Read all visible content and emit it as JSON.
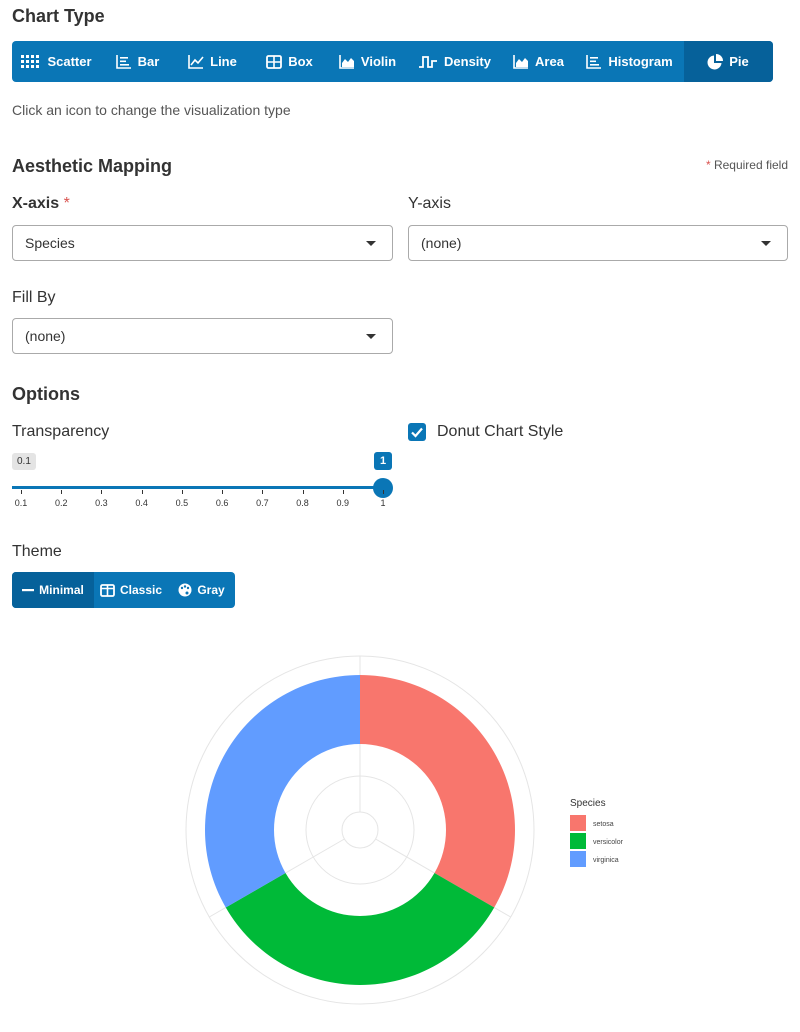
{
  "chart_type_section": {
    "title": "Chart Type",
    "buttons": [
      {
        "label": "Scatter",
        "icon": "scatter-icon"
      },
      {
        "label": "Bar",
        "icon": "bar-chart-icon"
      },
      {
        "label": "Line",
        "icon": "line-chart-icon"
      },
      {
        "label": "Box",
        "icon": "box-plot-icon"
      },
      {
        "label": "Violin",
        "icon": "violin-icon"
      },
      {
        "label": "Density",
        "icon": "density-icon"
      },
      {
        "label": "Area",
        "icon": "area-chart-icon"
      },
      {
        "label": "Histogram",
        "icon": "histogram-icon"
      },
      {
        "label": "Pie",
        "icon": "pie-chart-icon",
        "active": true
      }
    ],
    "helper": "Click an icon to change the visualization type"
  },
  "aesthetic": {
    "title": "Aesthetic Mapping",
    "required_note": "Required field",
    "x_axis": {
      "label": "X-axis",
      "value": "Species"
    },
    "y_axis": {
      "label": "Y-axis",
      "value": "(none)"
    },
    "fill_by": {
      "label": "Fill By",
      "value": "(none)"
    }
  },
  "options": {
    "title": "Options",
    "transparency": {
      "label": "Transparency",
      "min_label": "0.1",
      "value_label": "1",
      "value": 1,
      "min": 0.1,
      "max": 1,
      "ticks": [
        "0.1",
        "0.2",
        "0.3",
        "0.4",
        "0.5",
        "0.6",
        "0.7",
        "0.8",
        "0.9",
        "1"
      ]
    },
    "donut": {
      "label": "Donut Chart Style",
      "checked": true
    }
  },
  "theme": {
    "title": "Theme",
    "buttons": [
      {
        "label": "Minimal",
        "icon": "minus-icon",
        "active": true
      },
      {
        "label": "Classic",
        "icon": "columns-icon"
      },
      {
        "label": "Gray",
        "icon": "palette-icon"
      }
    ]
  },
  "colors": {
    "accent": "#0a76b6",
    "accent_active": "#06619a",
    "required": "#d9534f"
  },
  "chart_data": {
    "type": "pie",
    "style": "donut",
    "legend_title": "Species",
    "legend_position": "right",
    "categories": [
      "setosa",
      "versicolor",
      "virginica"
    ],
    "values": [
      50,
      50,
      50
    ],
    "colors": [
      "#F8766D",
      "#00BA38",
      "#619CFF"
    ]
  }
}
